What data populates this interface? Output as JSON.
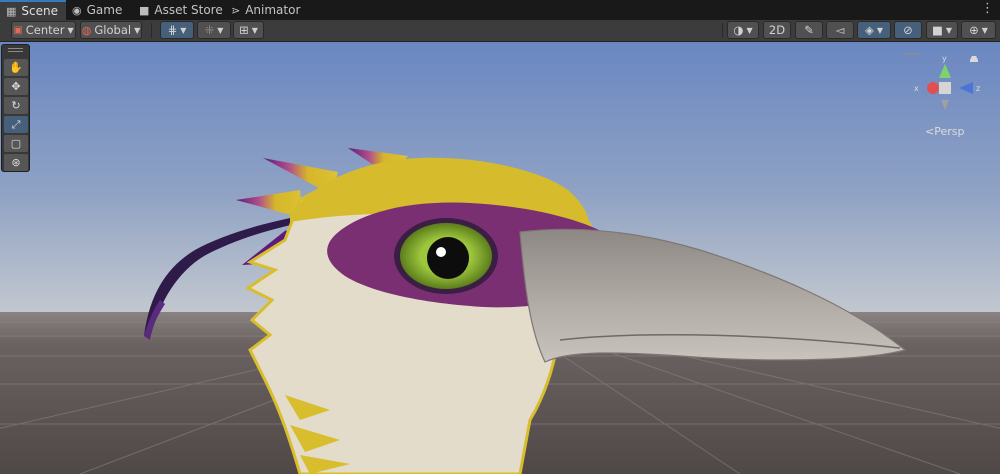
{
  "tabs": [
    {
      "label": "Scene",
      "icon": "scene-grid-icon",
      "active": true
    },
    {
      "label": "Game",
      "icon": "gamepad-icon",
      "active": false
    },
    {
      "label": "Asset Store",
      "icon": "shopping-bag-icon",
      "active": false
    },
    {
      "label": "Animator",
      "icon": "animator-icon",
      "active": false
    }
  ],
  "toolbar": {
    "pivot_label": "Center",
    "space_label": "Global",
    "mode_2d_label": "2D"
  },
  "gizmo": {
    "x_label": "x",
    "y_label": "y",
    "z_label": "z",
    "projection_label": "Persp"
  },
  "colors": {
    "sky_top": "#6c89c2",
    "sky_horizon": "#b9c2cf",
    "ground": "#5c5554",
    "feather_cream": "#e4dccb",
    "feather_yellow": "#d8bd2c",
    "mask_purple": "#7a2f73",
    "eye_green": "#7fa833",
    "beak_gray": "#a29c97",
    "accent_selected": "#46607c"
  }
}
